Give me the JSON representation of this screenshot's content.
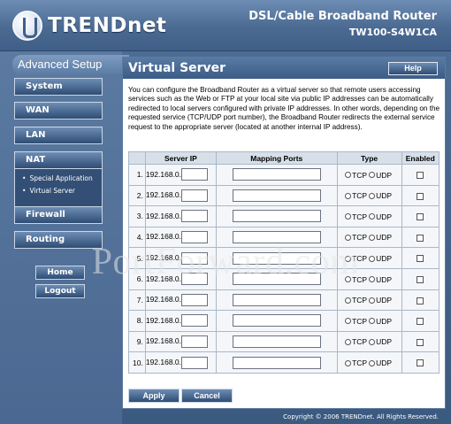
{
  "header": {
    "logo_text": "TRENDnet",
    "product_title": "DSL/Cable Broadband Router",
    "model": "TW100-S4W1CA"
  },
  "sidebar": {
    "section_label": "Advanced Setup",
    "items": [
      {
        "label": "System"
      },
      {
        "label": "WAN"
      },
      {
        "label": "LAN"
      },
      {
        "label": "NAT"
      },
      {
        "label": "Firewall"
      },
      {
        "label": "Routing"
      }
    ],
    "nat_subitems": [
      {
        "label": "Special Application"
      },
      {
        "label": "Virtual Server"
      }
    ],
    "home_label": "Home",
    "logout_label": "Logout"
  },
  "main": {
    "title": "Virtual Server",
    "help_label": "Help",
    "intro": "You can configure the Broadband Router as a virtual server so that remote users accessing services such as the Web or FTP at your local site via public IP addresses can be automatically redirected to local servers configured with private IP addresses. In other words, depending on the requested service (TCP/UDP port number), the Broadband Router redirects the external service request to the appropriate server (located at another internal IP address).",
    "table": {
      "headers": [
        "",
        "Server IP",
        "Mapping Ports",
        "Type",
        "Enabled"
      ],
      "ip_prefix": "192.168.0.",
      "type_tcp": "TCP",
      "type_udp": "UDP",
      "rows": [
        {
          "num": "1."
        },
        {
          "num": "2."
        },
        {
          "num": "3."
        },
        {
          "num": "4."
        },
        {
          "num": "5."
        },
        {
          "num": "6."
        },
        {
          "num": "7."
        },
        {
          "num": "8."
        },
        {
          "num": "9."
        },
        {
          "num": "10."
        }
      ]
    },
    "apply_label": "Apply",
    "cancel_label": "Cancel"
  },
  "watermark": "PortForward.com",
  "footer": {
    "copyright": "Copyright © 2006 TRENDnet. All Rights Reserved."
  }
}
